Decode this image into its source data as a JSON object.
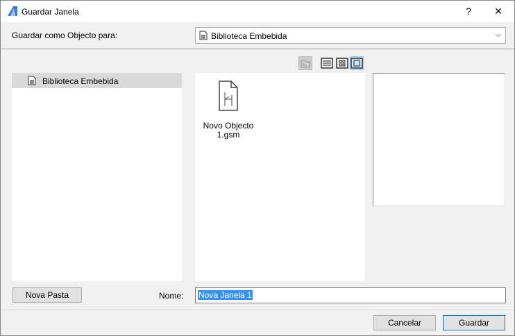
{
  "window": {
    "title": "Guardar Janela",
    "help": "?",
    "close": "✕"
  },
  "save_as": {
    "label": "Guardar como Objecto para:",
    "selected": "Biblioteca Embebida"
  },
  "tree": {
    "items": [
      {
        "label": "Biblioteca Embebida"
      }
    ]
  },
  "files": [
    {
      "label": "Novo Objecto 1.gsm"
    }
  ],
  "buttons": {
    "new_folder": "Nova Pasta",
    "cancel": "Cancelar",
    "save": "Guardar"
  },
  "name": {
    "label": "Nome:",
    "value": "Nova Janela 1"
  }
}
